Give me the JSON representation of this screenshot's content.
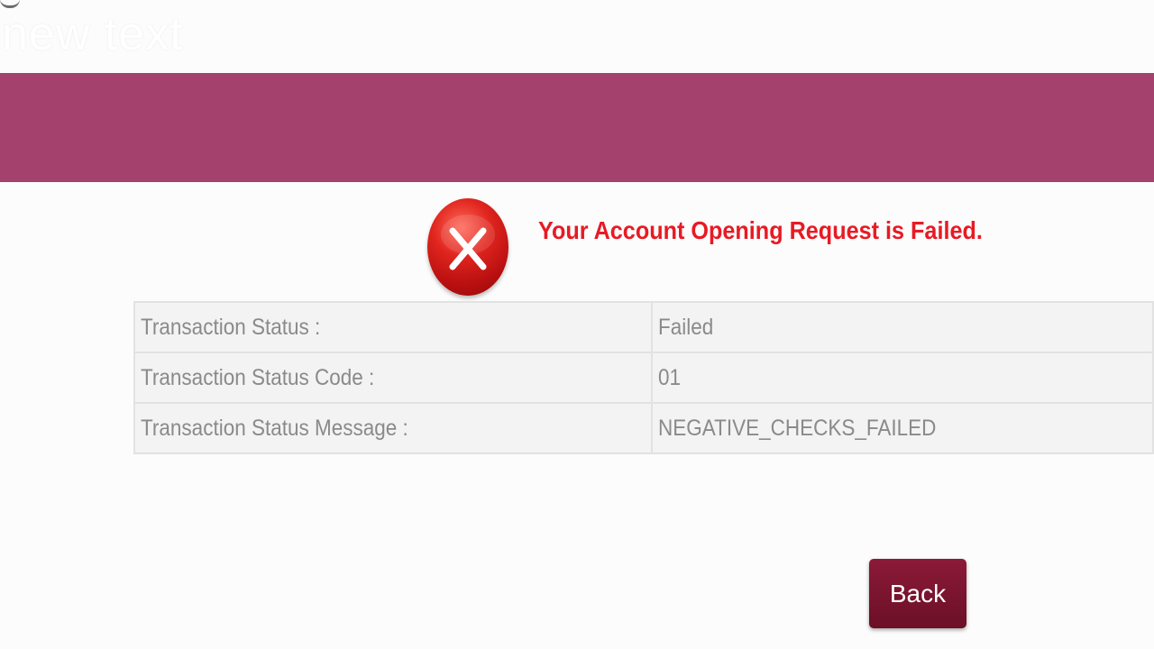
{
  "watermark": "new text",
  "status": {
    "title": "Your Account Opening Request is Failed.",
    "icon": "error-x-icon",
    "color": "#e81a24"
  },
  "details": {
    "rows": [
      {
        "label": "Transaction Status :",
        "value": "Failed"
      },
      {
        "label": "Transaction Status Code :",
        "value": "01"
      },
      {
        "label": "Transaction Status Message :",
        "value": "NEGATIVE_CHECKS_FAILED"
      }
    ]
  },
  "actions": {
    "back_label": "Back"
  },
  "theme": {
    "banner": "#a4416c",
    "button": "#7a1430"
  }
}
